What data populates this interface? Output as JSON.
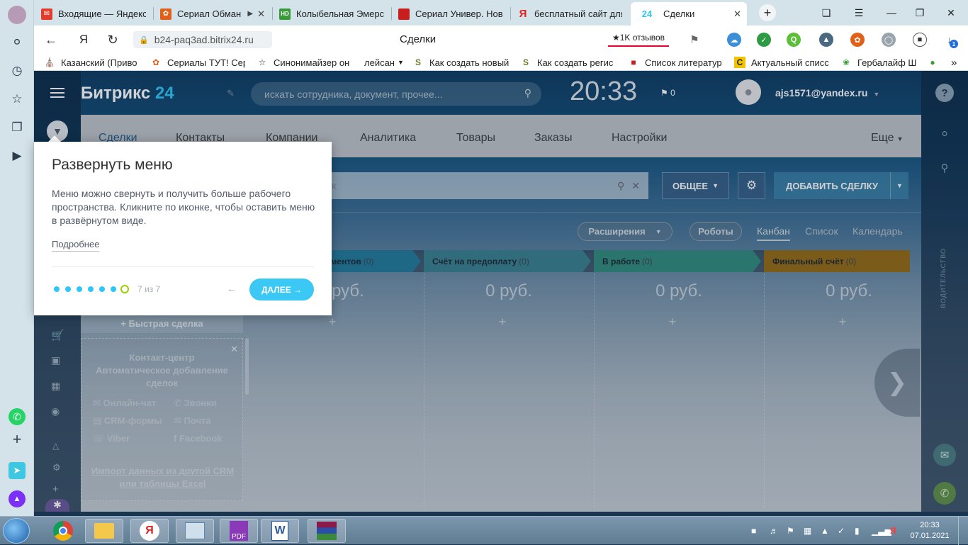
{
  "browser": {
    "tabs": [
      {
        "title": "Входящие — Яндекс",
        "icon": "mail-icon",
        "color": "#e23c2b"
      },
      {
        "title": "Сериал Обман",
        "icon": "fox-icon",
        "color": "#e06018"
      },
      {
        "title": "Колыбельная Эмерс",
        "icon": "hd-icon",
        "color": "#3a9a3a"
      },
      {
        "title": "Сериал Универ. Нов",
        "icon": "book-icon",
        "color": "#c81e1e"
      },
      {
        "title": "бесплатный сайт для",
        "icon": "yandex-icon",
        "color": "#e02020"
      },
      {
        "title": "Сделки",
        "icon": "bitrix-icon",
        "color": "#2fc6f6"
      }
    ],
    "new_tab_symbol": "+",
    "address": {
      "url": "b24-paq3ad.bitrix24.ru",
      "page_title": "Сделки",
      "reviews": "★1K отзывов",
      "yandex_logo": "Я"
    },
    "ext_badge": "1",
    "bookmarks": [
      {
        "label": "Казанский (Приво",
        "icon": "bank-icon"
      },
      {
        "label": "Сериалы ТУТ! Сер",
        "icon": "fox-icon"
      },
      {
        "label": "Синонимайзер он",
        "icon": "star-icon"
      },
      {
        "label": "лейсан",
        "icon": "folder-icon"
      },
      {
        "label": "Как создать новый",
        "icon": "s-icon"
      },
      {
        "label": "Как создать регис",
        "icon": "s-icon"
      },
      {
        "label": "Список литератур",
        "icon": "book-icon"
      },
      {
        "label": "Актуальный списс",
        "icon": "c-icon"
      },
      {
        "label": "Гербалайф Ш",
        "icon": "leaf-icon"
      }
    ],
    "bookmarks_more": "»"
  },
  "bitrix": {
    "logo_main": "Битрикс ",
    "logo_num": "24",
    "search_placeholder": "искать сотрудника, документ, прочее...",
    "clock": "20:33",
    "notifications": "0",
    "user": "ajs1571@yandex.ru",
    "menu": [
      "Сделки",
      "Контакты",
      "Компании",
      "Аналитика",
      "Товары",
      "Заказы",
      "Настройки"
    ],
    "menu_more": "Еще",
    "filter_text": "к",
    "general_btn": "ОБЩЕЕ",
    "add_deal_btn": "ДОБАВИТЬ СДЕЛКУ",
    "extensions": "Расширения",
    "robots": "Роботы",
    "views": [
      "Канбан",
      "Список",
      "Календарь"
    ],
    "stages": [
      {
        "name": "ументов",
        "count": "(0)",
        "color": "#2fc6f6"
      },
      {
        "name": "Счёт на предоплату",
        "count": "(0)",
        "color": "#55d0e0"
      },
      {
        "name": "В работе",
        "count": "(0)",
        "color": "#47e4c2"
      },
      {
        "name": "Финальный счёт",
        "count": "(0)",
        "color": "#ffa900"
      }
    ],
    "sums": [
      "руб.",
      "0 руб.",
      "0 руб.",
      "0 руб."
    ],
    "quick_deal": "+ Быстрая сделка",
    "contact_center": {
      "title": "Контакт-центр",
      "subtitle": "Автоматическое добавление сделок",
      "channels": [
        "Онлайн-чат",
        "Звонки",
        "CRM-формы",
        "Почта",
        "Viber",
        "Facebook"
      ],
      "import": "Импорт данных из другой CRM или таблицы Excel"
    },
    "right_vertical": "ВОДИТЕЛЬСТВО"
  },
  "popup": {
    "title": "Развернуть меню",
    "text": "Меню можно свернуть и получить больше рабочего пространства. Кликните по иконке, чтобы оставить меню в развёрнутом виде.",
    "more": "Подробнее",
    "step": "7 из 7",
    "back": "←",
    "next": "ДАЛЕЕ →"
  },
  "taskbar": {
    "time": "20:33",
    "date": "07.01.2021",
    "apps": [
      "explorer-icon",
      "yandex-browser-icon",
      "control-panel-icon",
      "pdf-icon",
      "word-icon",
      "winrar-icon"
    ]
  }
}
